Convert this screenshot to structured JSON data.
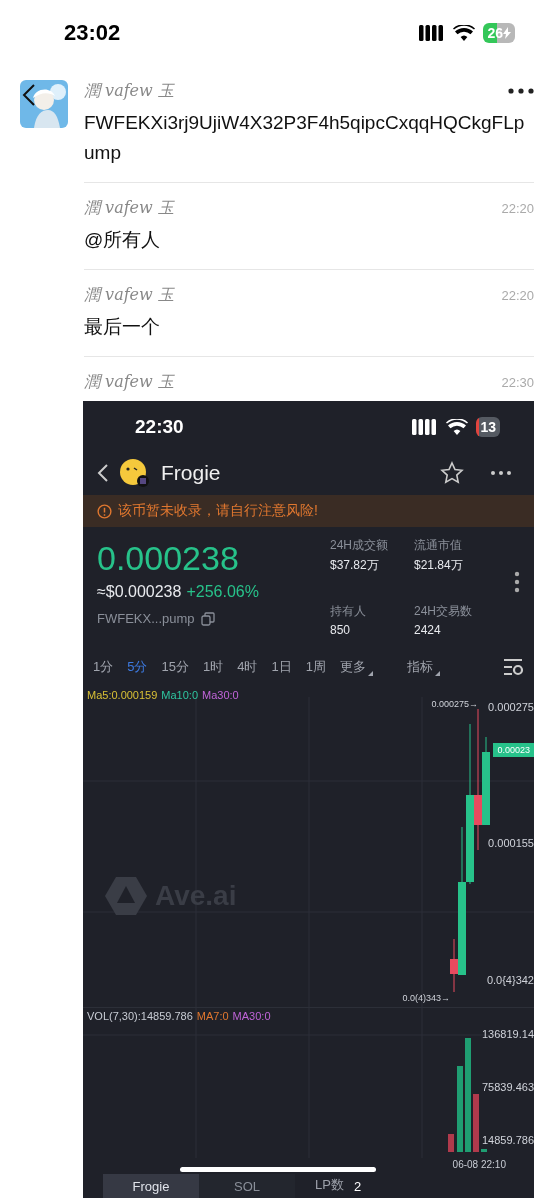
{
  "status_bar": {
    "time": "23:02",
    "battery": "26",
    "charging": true
  },
  "messages": [
    {
      "kind": "text",
      "sender": "潤 vafew 玉",
      "avatar": true,
      "overlay_menu": true,
      "text": "FWFEKXi3rj9UjiW4X32P3F4h5qipcCxqqHQCkgFLpump"
    },
    {
      "kind": "text",
      "sender": "潤 vafew 玉",
      "time": "22:20",
      "text": "@所有人"
    },
    {
      "kind": "text",
      "sender": "潤 vafew 玉",
      "time": "22:20",
      "text": "最后一个"
    },
    {
      "kind": "image",
      "sender": "潤 vafew 玉",
      "time": "22:30"
    }
  ],
  "shared_screenshot": {
    "status_bar": {
      "time": "22:30",
      "battery": "13"
    },
    "title": "Frogie",
    "warning": "该币暂未收录，请自行注意风险!",
    "price": "0.000238",
    "usd_price": "≈$0.000238",
    "change": "+256.06%",
    "address": "FWFEKX...pump",
    "stats": [
      {
        "label": "24H成交额",
        "value": "$37.82万"
      },
      {
        "label": "流通市值",
        "value": "$21.84万"
      },
      {
        "label": "持有人",
        "value": "850"
      },
      {
        "label": "24H交易数",
        "value": "2424"
      }
    ],
    "intervals": [
      {
        "label": "1分",
        "selected": false,
        "dropdown": false
      },
      {
        "label": "5分",
        "selected": true,
        "dropdown": false
      },
      {
        "label": "15分",
        "selected": false,
        "dropdown": false
      },
      {
        "label": "1时",
        "selected": false,
        "dropdown": false
      },
      {
        "label": "4时",
        "selected": false,
        "dropdown": false
      },
      {
        "label": "1日",
        "selected": false,
        "dropdown": false
      },
      {
        "label": "1周",
        "selected": false,
        "dropdown": false
      },
      {
        "label": "更多",
        "selected": false,
        "dropdown": true
      },
      {
        "label": "指标",
        "selected": false,
        "dropdown": true
      }
    ],
    "ma_legend": [
      {
        "text": "Ma5:0.000159",
        "color": "#d8c035"
      },
      {
        "text": "Ma10:0",
        "color": "#2ec6a0"
      },
      {
        "text": "Ma30:0",
        "color": "#c064d8"
      }
    ],
    "watermark": "Ave.ai",
    "price_labels": [
      {
        "kind": "marker",
        "text": "0.000275→"
      },
      {
        "kind": "axis",
        "text": "0.000275"
      },
      {
        "kind": "current",
        "text": "0.00023"
      },
      {
        "kind": "axis",
        "text": "0.000155"
      },
      {
        "kind": "axis",
        "text": "0.0{4}342"
      },
      {
        "kind": "marker",
        "text": "0.0(4)343→"
      }
    ],
    "vol_legend": [
      {
        "text": "VOL(7,30):14859.786",
        "color": "#c8ccd4"
      },
      {
        "text": "MA7:0",
        "color": "#e0772f"
      },
      {
        "text": "MA30:0",
        "color": "#c064d8"
      }
    ],
    "vol_labels": [
      "136819.14",
      "75839.463",
      "14859.786"
    ],
    "date_label": "06-08 22:10",
    "bottom_tabs": [
      {
        "label": "Frogie",
        "selected": true
      },
      {
        "label": "SOL",
        "selected": false
      }
    ],
    "lp": {
      "label": "LP数",
      "value": "2"
    }
  }
}
